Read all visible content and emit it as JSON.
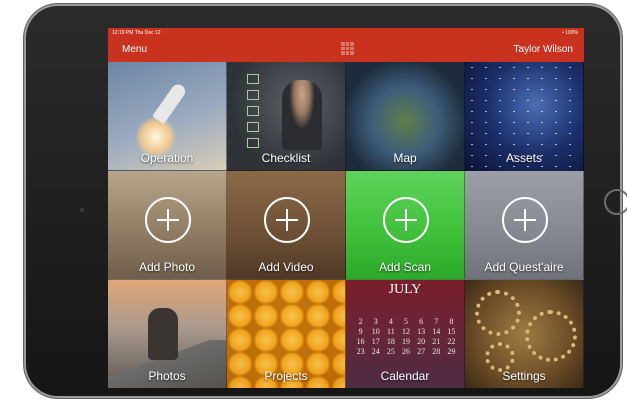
{
  "status": {
    "time": "12:19 PM  Thu Dec 12",
    "battery": "• 100%"
  },
  "nav": {
    "menu_label": "Menu",
    "user_name": "Taylor Wilson"
  },
  "tiles": [
    {
      "label": "Operation"
    },
    {
      "label": "Checklist"
    },
    {
      "label": "Map"
    },
    {
      "label": "Assets"
    },
    {
      "label": "Add Photo"
    },
    {
      "label": "Add Video"
    },
    {
      "label": "Add Scan"
    },
    {
      "label": "Add Quest'aire"
    },
    {
      "label": "Photos"
    },
    {
      "label": "Projects"
    },
    {
      "label": "Calendar"
    },
    {
      "label": "Settings"
    }
  ],
  "calendar": {
    "month": "JULY",
    "days": [
      "",
      "",
      "",
      "",
      "",
      "",
      "",
      "2",
      "3",
      "4",
      "5",
      "6",
      "7",
      "8",
      "9",
      "10",
      "11",
      "12",
      "13",
      "14",
      "15",
      "16",
      "17",
      "18",
      "19",
      "20",
      "21",
      "22",
      "23",
      "24",
      "25",
      "26",
      "27",
      "28",
      "29"
    ]
  },
  "icons": [
    "grid-icon",
    "plus-icon",
    "rocket-icon",
    "gear-icon"
  ],
  "colors": {
    "accent": "#c8321f",
    "scan_green": "#3fbf3a"
  }
}
